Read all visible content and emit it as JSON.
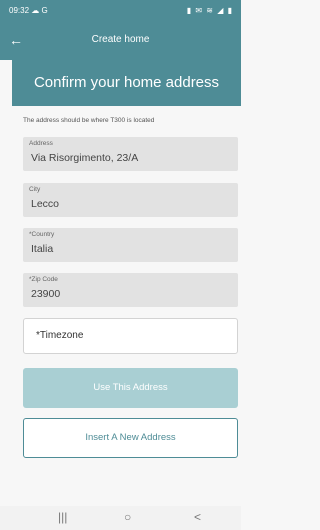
{
  "status_bar": {
    "time": "09:32",
    "left_icons": "☁ G",
    "right_icons": "▮ ✉ ≋ ◢ ▮"
  },
  "app_bar": {
    "title": "Create home",
    "back_icon": "←"
  },
  "banner": {
    "heading": "Confirm your home address"
  },
  "helper_text": "The address should be where T300 is located",
  "fields": [
    {
      "label": "Address",
      "value": "Via Risorgimento, 23/A"
    },
    {
      "label": "City",
      "value": "Lecco"
    },
    {
      "label": "*Country",
      "value": "Italia"
    },
    {
      "label": "*Zip Code",
      "value": "23900"
    }
  ],
  "timezone": {
    "placeholder": "*Timezone"
  },
  "buttons": {
    "use_address": "Use This Address",
    "insert_new": "Insert A New Address"
  },
  "colors": {
    "primary": "#4e8c96",
    "disabled_button": "#a9cfd3",
    "field_bg": "#e2e2e2"
  },
  "nav": {
    "recents_icon": "|||",
    "home_icon": "○",
    "back_icon": "<"
  }
}
